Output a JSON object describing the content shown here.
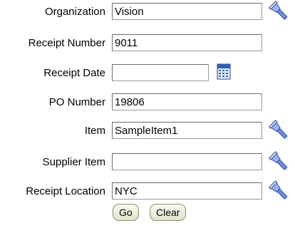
{
  "form": {
    "fields": [
      {
        "label": "Organization",
        "value": "Vision",
        "icon": "flashlight-search-icon"
      },
      {
        "label": "Receipt Number",
        "value": "9011",
        "icon": ""
      },
      {
        "label": "Receipt Date",
        "value": "",
        "icon": "calendar-icon"
      },
      {
        "label": "PO Number",
        "value": "19806",
        "icon": ""
      },
      {
        "label": "Item",
        "value": "SampleItem1",
        "icon": "flashlight-search-icon"
      },
      {
        "label": "Supplier Item",
        "value": "",
        "icon": "flashlight-search-icon"
      },
      {
        "label": "Receipt Location",
        "value": "NYC",
        "icon": "flashlight-search-icon"
      }
    ],
    "go_label": "Go",
    "clear_label": "Clear"
  },
  "colors": {
    "icon_blue": "#3a63c4",
    "calendar_blue": "#2f5fa8"
  }
}
